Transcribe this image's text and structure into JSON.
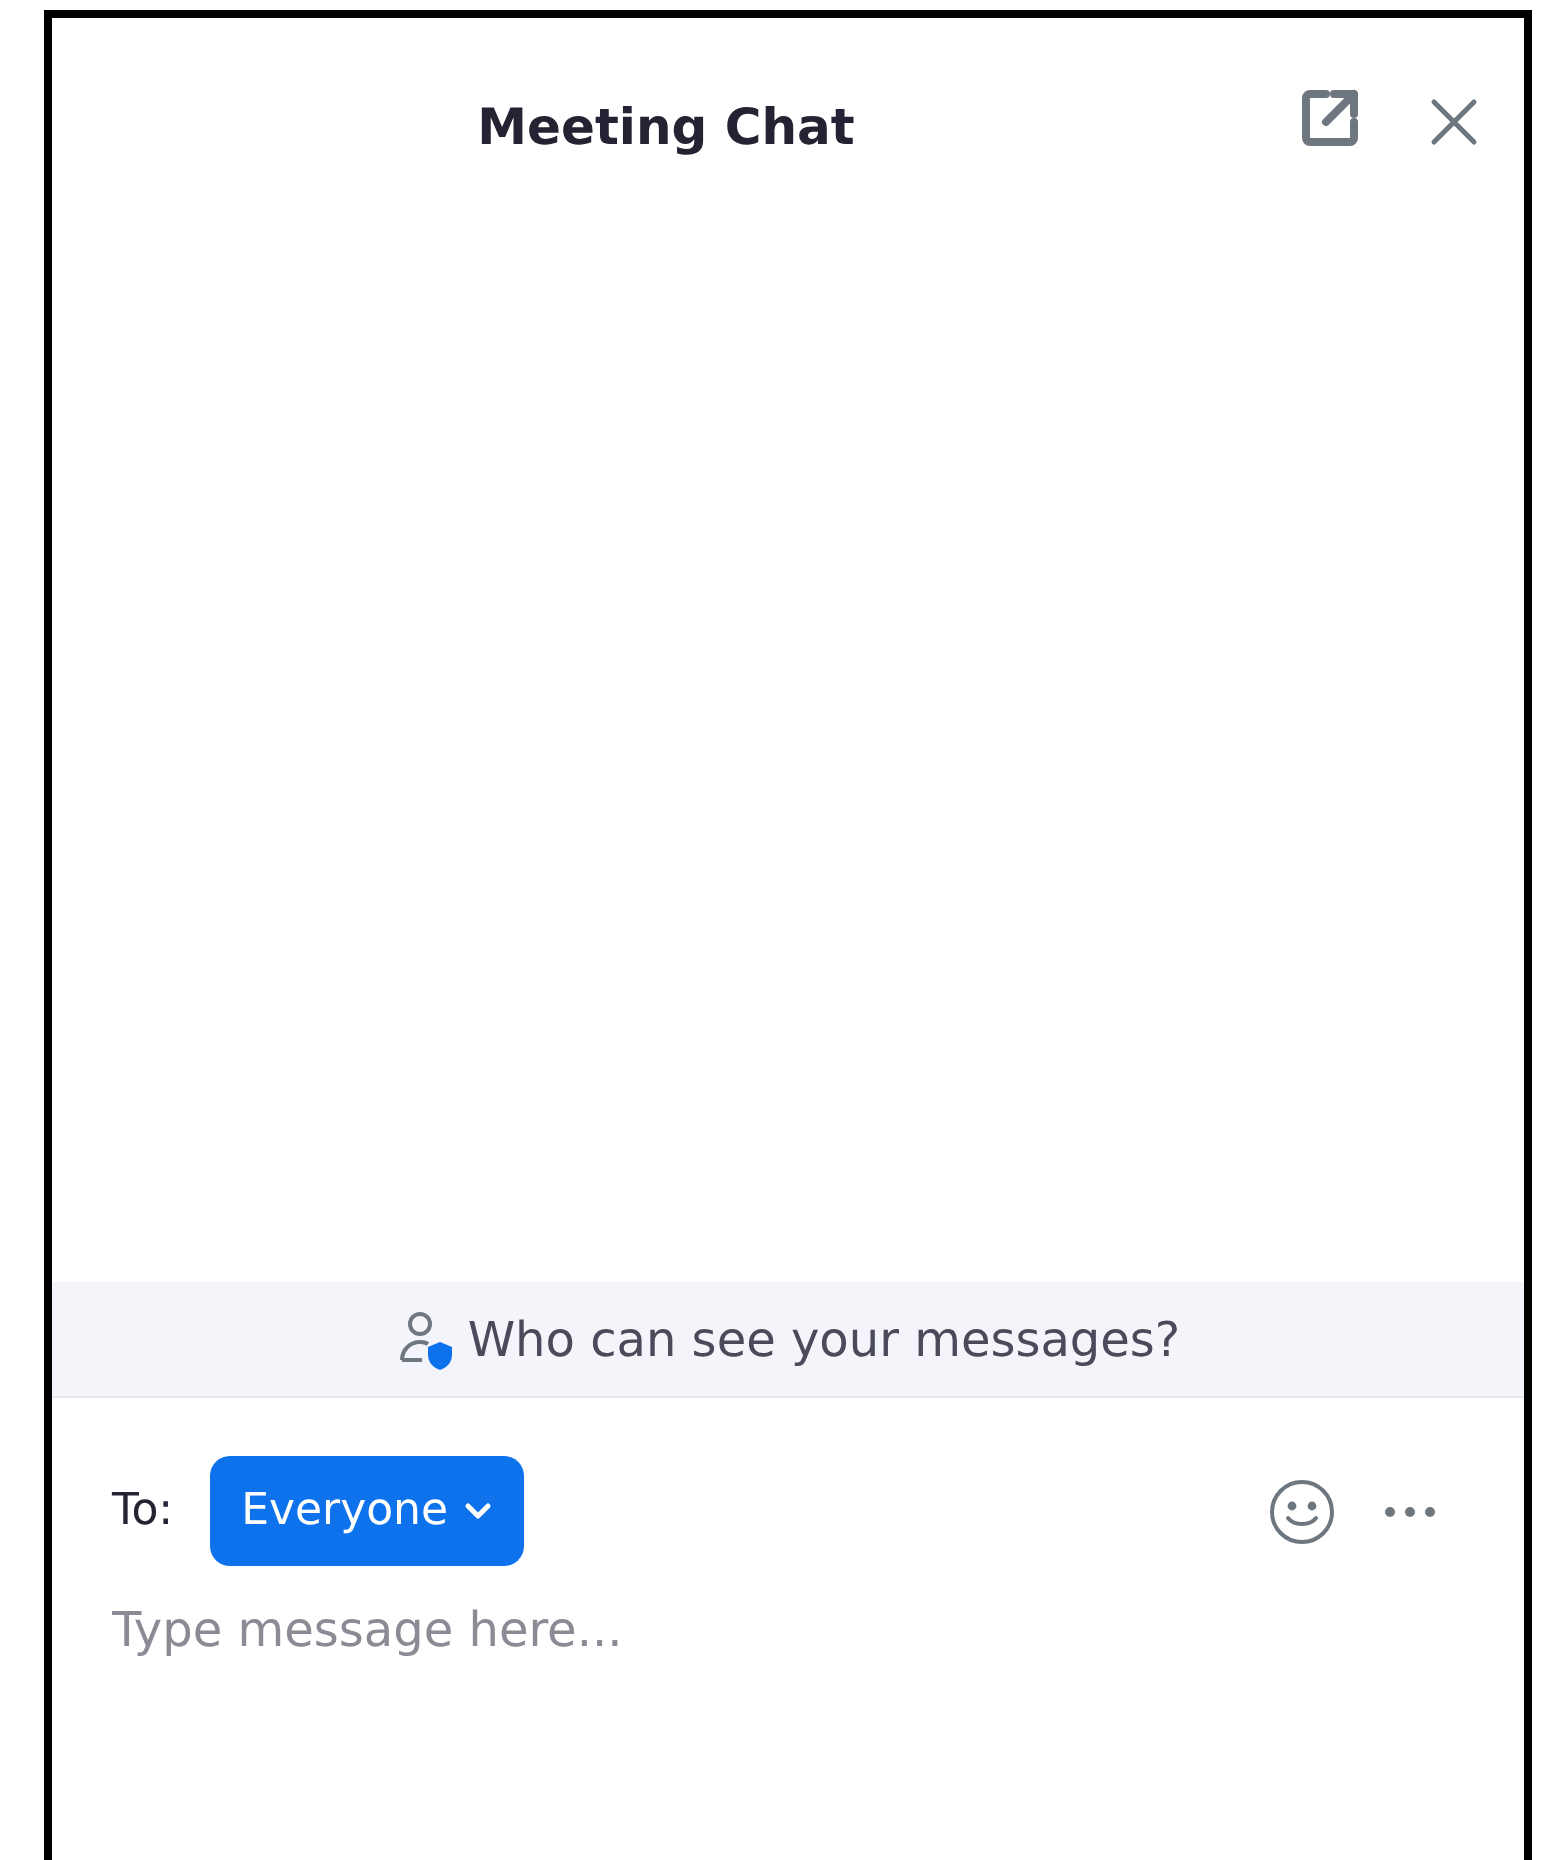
{
  "header": {
    "title": "Meeting Chat"
  },
  "privacy_banner": {
    "text": "Who can see your messages?"
  },
  "recipient": {
    "label": "To:",
    "value": "Everyone"
  },
  "message_field": {
    "placeholder": "Type message here..."
  }
}
